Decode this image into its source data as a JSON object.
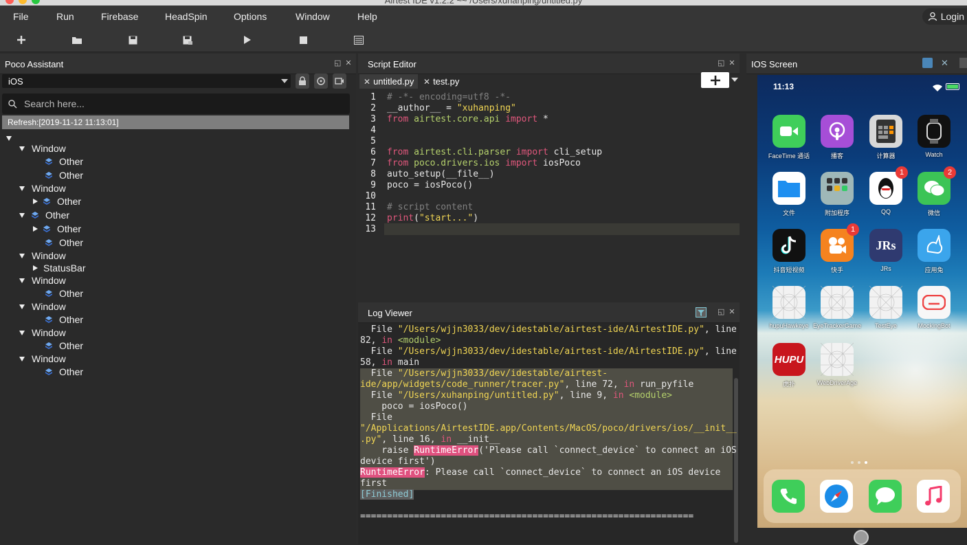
{
  "window": {
    "title": "Airtest IDE v1.2.2 ~~ /Users/xuhanping/untitled.py"
  },
  "menu": {
    "items": [
      "File",
      "Run",
      "Firebase",
      "HeadSpin",
      "Options",
      "Window",
      "Help"
    ],
    "login": "Login"
  },
  "toolbar": {
    "icons": [
      "plus-icon",
      "folder-open-icon",
      "save-icon",
      "save-as-icon",
      "play-icon",
      "stop-icon",
      "log-icon"
    ]
  },
  "poco": {
    "title": "Poco Assistant",
    "platform": "iOS",
    "search_placeholder": "Search here...",
    "refresh": "Refresh:[2019-11-12 11:13:01]",
    "tree": [
      {
        "label": "Window"
      },
      {
        "label": "Other"
      },
      {
        "label": "Other"
      },
      {
        "label": "Window"
      },
      {
        "label": "Other"
      },
      {
        "label": "Other"
      },
      {
        "label": "Other"
      },
      {
        "label": "Other"
      },
      {
        "label": "Window"
      },
      {
        "label": "StatusBar"
      },
      {
        "label": "Window"
      },
      {
        "label": "Other"
      },
      {
        "label": "Window"
      },
      {
        "label": "Other"
      },
      {
        "label": "Window"
      },
      {
        "label": "Other"
      },
      {
        "label": "Window"
      },
      {
        "label": "Other"
      }
    ]
  },
  "editor": {
    "title": "Script Editor",
    "tabs": [
      "untitled.py",
      "test.py"
    ],
    "line_numbers": [
      "1",
      "2",
      "3",
      "4",
      "5",
      "6",
      "7",
      "8",
      "9",
      "10",
      "11",
      "12",
      "13"
    ],
    "lines": [
      [
        {
          "t": "# -*- encoding=utf8 -*-",
          "c": "cm"
        }
      ],
      [
        {
          "t": "__author__ = ",
          "c": ""
        },
        {
          "t": "\"xuhanping\"",
          "c": "str"
        }
      ],
      [
        {
          "t": "from ",
          "c": "kw"
        },
        {
          "t": "airtest.core.api ",
          "c": "md"
        },
        {
          "t": "import",
          "c": "kw"
        },
        {
          "t": " *",
          "c": ""
        }
      ],
      [],
      [],
      [
        {
          "t": "from ",
          "c": "kw"
        },
        {
          "t": "airtest.cli.parser ",
          "c": "md"
        },
        {
          "t": "import",
          "c": "kw"
        },
        {
          "t": " cli_setup",
          "c": ""
        }
      ],
      [
        {
          "t": "from ",
          "c": "kw"
        },
        {
          "t": "poco.drivers.ios ",
          "c": "md"
        },
        {
          "t": "import",
          "c": "kw"
        },
        {
          "t": " iosPoco",
          "c": ""
        }
      ],
      [
        {
          "t": "auto_setup(__file__)",
          "c": ""
        }
      ],
      [
        {
          "t": "poco = iosPoco()",
          "c": ""
        }
      ],
      [],
      [
        {
          "t": "# script content",
          "c": "cm"
        }
      ],
      [
        {
          "t": "print",
          "c": "kw"
        },
        {
          "t": "(",
          "c": ""
        },
        {
          "t": "\"start...\"",
          "c": "str"
        },
        {
          "t": ")",
          "c": ""
        }
      ],
      []
    ]
  },
  "log": {
    "title": "Log Viewer",
    "lines": [
      [
        {
          "t": "  File ",
          "c": ""
        },
        {
          "t": "\"/Users/wjjn3033/dev/idestable/airtest-ide/AirtestIDE.py\"",
          "c": "str"
        },
        {
          "t": ", line",
          "c": ""
        }
      ],
      [
        {
          "t": "82",
          "c": ""
        },
        {
          "t": ", ",
          "c": ""
        },
        {
          "t": "in",
          "c": "kw"
        },
        {
          "t": " <module>",
          "c": "md"
        }
      ],
      [
        {
          "t": "  File ",
          "c": ""
        },
        {
          "t": "\"/Users/wjjn3033/dev/idestable/airtest-ide/AirtestIDE.py\"",
          "c": "str"
        },
        {
          "t": ", line",
          "c": ""
        }
      ],
      [
        {
          "t": "58",
          "c": ""
        },
        {
          "t": ", ",
          "c": ""
        },
        {
          "t": "in",
          "c": "kw"
        },
        {
          "t": " main",
          "c": ""
        }
      ],
      [
        {
          "t": "  File ",
          "c": ""
        },
        {
          "t": "\"/Users/wjjn3033/dev/idestable/airtest-",
          "c": "str"
        }
      ],
      [
        {
          "t": "ide/app/widgets/code_runner/tracer.py\"",
          "c": "str"
        },
        {
          "t": ", line 72, ",
          "c": ""
        },
        {
          "t": "in",
          "c": "kw"
        },
        {
          "t": " run_pyfile",
          "c": ""
        }
      ],
      [
        {
          "t": "  File ",
          "c": ""
        },
        {
          "t": "\"/Users/xuhanping/untitled.py\"",
          "c": "str"
        },
        {
          "t": ", line 9, ",
          "c": ""
        },
        {
          "t": "in",
          "c": "kw"
        },
        {
          "t": " <module>",
          "c": "md"
        }
      ],
      [
        {
          "t": "    poco = iosPoco()",
          "c": ""
        }
      ],
      [
        {
          "t": "  File",
          "c": ""
        }
      ],
      [
        {
          "t": "\"/Applications/AirtestIDE.app/Contents/MacOS/poco/drivers/ios/__init__",
          "c": "str"
        }
      ],
      [
        {
          "t": ".py\"",
          "c": "str"
        },
        {
          "t": ", line 16, ",
          "c": ""
        },
        {
          "t": "in",
          "c": "kw"
        },
        {
          "t": " __init__",
          "c": ""
        }
      ],
      [
        {
          "t": "    raise ",
          "c": ""
        },
        {
          "t": "RuntimeError",
          "c": "err"
        },
        {
          "t": "('Please call `connect_device` to connect an iOS",
          "c": ""
        }
      ],
      [
        {
          "t": "device first')",
          "c": ""
        }
      ],
      [
        {
          "t": "RuntimeError",
          "c": "err"
        },
        {
          "t": ": Please call `connect_device` to connect an iOS device",
          "c": ""
        }
      ],
      [
        {
          "t": "first",
          "c": ""
        }
      ],
      [
        {
          "t": "[Finished]",
          "c": "fin"
        }
      ],
      [],
      [
        {
          "t": "==============================================================",
          "c": ""
        }
      ]
    ]
  },
  "ios": {
    "title": "IOS Screen",
    "time": "11:13",
    "apps": [
      {
        "label": "FaceTime 通话",
        "icon": "facetime-icon",
        "color": "#3fce5a",
        "badge": ""
      },
      {
        "label": "播客",
        "icon": "podcasts-icon",
        "color": "#a64ed7",
        "badge": ""
      },
      {
        "label": "计算器",
        "icon": "calculator-icon",
        "color": "#d8d8d8",
        "badge": ""
      },
      {
        "label": "Watch",
        "icon": "watch-icon",
        "color": "#111111",
        "badge": ""
      },
      {
        "label": "文件",
        "icon": "files-icon",
        "color": "#ffffff",
        "badge": ""
      },
      {
        "label": "附加程序",
        "icon": "folder-apps-icon",
        "color": "#9fb8b8",
        "badge": ""
      },
      {
        "label": "QQ",
        "icon": "qq-icon",
        "color": "#ffffff",
        "badge": "1"
      },
      {
        "label": "微信",
        "icon": "wechat-icon",
        "color": "#3cc456",
        "badge": "2"
      },
      {
        "label": "抖音短视频",
        "icon": "douyin-icon",
        "color": "#111111",
        "badge": ""
      },
      {
        "label": "快手",
        "icon": "kuaishou-icon",
        "color": "#f5831f",
        "badge": "1"
      },
      {
        "label": "JRs",
        "icon": "jrs-icon",
        "color": "#2f3a70",
        "badge": ""
      },
      {
        "label": "应用兔",
        "icon": "rabbit-icon",
        "color": "#3ba5ec",
        "badge": ""
      },
      {
        "label": "hupuHawkeye",
        "icon": "grid-app-icon",
        "color": "#f2f2f2",
        "badge": ""
      },
      {
        "label": "EyeTrackerGame",
        "icon": "grid-app-icon",
        "color": "#f2f2f2",
        "badge": ""
      },
      {
        "label": "TestEye",
        "icon": "grid-app-icon",
        "color": "#f2f2f2",
        "badge": ""
      },
      {
        "label": "MockingBot",
        "icon": "mockingbot-icon",
        "color": "#f7f7f7",
        "badge": ""
      },
      {
        "label": "虎扑",
        "icon": "hupu-icon",
        "color": "#c8161d",
        "badge": ""
      },
      {
        "label": "WebDriverAge",
        "icon": "grid-app-icon",
        "color": "#f2f2f2",
        "badge": ""
      }
    ],
    "hupu_text": "HUPU",
    "jrs_text": "JRs",
    "dock": [
      {
        "icon": "phone-icon",
        "color": "#3fce5a"
      },
      {
        "icon": "safari-icon",
        "color": "#ffffff"
      },
      {
        "icon": "messages-icon",
        "color": "#3fce5a"
      },
      {
        "icon": "music-icon",
        "color": "#ffffff"
      }
    ]
  }
}
